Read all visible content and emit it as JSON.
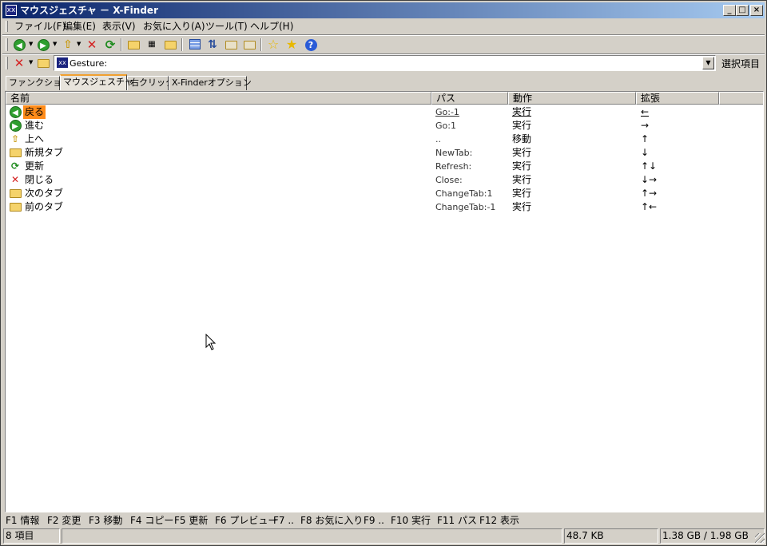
{
  "window": {
    "title": "マウスジェスチャ － X-Finder",
    "app_icon": "xx",
    "minimize": "_",
    "maximize": "□",
    "close": "×"
  },
  "menu": [
    "ファイル(F)",
    "編集(E)",
    "表示(V)",
    "お気に入り(A)",
    "ツール(T)",
    "ヘルプ(H)"
  ],
  "toolbar": {
    "buttons": [
      "back-icon",
      "forward-icon",
      "up-icon",
      "delete-icon",
      "refresh-icon",
      "folder-open-icon",
      "new-folder-icon",
      "folder-icon",
      "view-grid-icon",
      "sort-icon",
      "copy-icon",
      "move-icon",
      "favorites-star-icon",
      "add-favorite-icon",
      "help-icon"
    ]
  },
  "address": {
    "value": "Gesture:",
    "select_label": "選択項目"
  },
  "tabs": [
    {
      "label": "ファンクション",
      "active": false
    },
    {
      "label": "マウスジェスチャ",
      "active": true
    },
    {
      "label": "右クリック",
      "active": false
    },
    {
      "label": "X-Finderオプション",
      "active": false
    }
  ],
  "columns": [
    "名前",
    "パス",
    "動作",
    "拡張"
  ],
  "rows": [
    {
      "icon": "back-icon",
      "name": "戻る",
      "path": "Go:-1",
      "action": "実行",
      "gesture": "←",
      "selected": true
    },
    {
      "icon": "forward-icon",
      "name": "進む",
      "path": "Go:1",
      "action": "実行",
      "gesture": "→",
      "selected": false
    },
    {
      "icon": "up-icon",
      "name": "上へ",
      "path": "..",
      "action": "移動",
      "gesture": "↑",
      "selected": false
    },
    {
      "icon": "new-tab-icon",
      "name": "新規タブ",
      "path": "NewTab:",
      "action": "実行",
      "gesture": "↓",
      "selected": false
    },
    {
      "icon": "refresh-icon",
      "name": "更新",
      "path": "Refresh:",
      "action": "実行",
      "gesture": "↑↓",
      "selected": false
    },
    {
      "icon": "close-icon",
      "name": "閉じる",
      "path": "Close:",
      "action": "実行",
      "gesture": "↓→",
      "selected": false
    },
    {
      "icon": "folder-icon",
      "name": "次のタブ",
      "path": "ChangeTab:1",
      "action": "実行",
      "gesture": "↑→",
      "selected": false
    },
    {
      "icon": "folder-icon",
      "name": "前のタブ",
      "path": "ChangeTab:-1",
      "action": "実行",
      "gesture": "↑←",
      "selected": false
    }
  ],
  "fkeys": [
    "F1 情報",
    "F2 変更",
    "F3 移動",
    "F4 コピー",
    "F5 更新",
    "F6 プレビュー",
    "F7 ..",
    "F8 お気に入り",
    "F9 ..",
    "F10 実行",
    "F11 パス",
    "F12 表示"
  ],
  "status": {
    "items": "8 項目",
    "middle": "",
    "size": "48.7 KB",
    "disk": "1.38 GB / 1.98 GB"
  }
}
